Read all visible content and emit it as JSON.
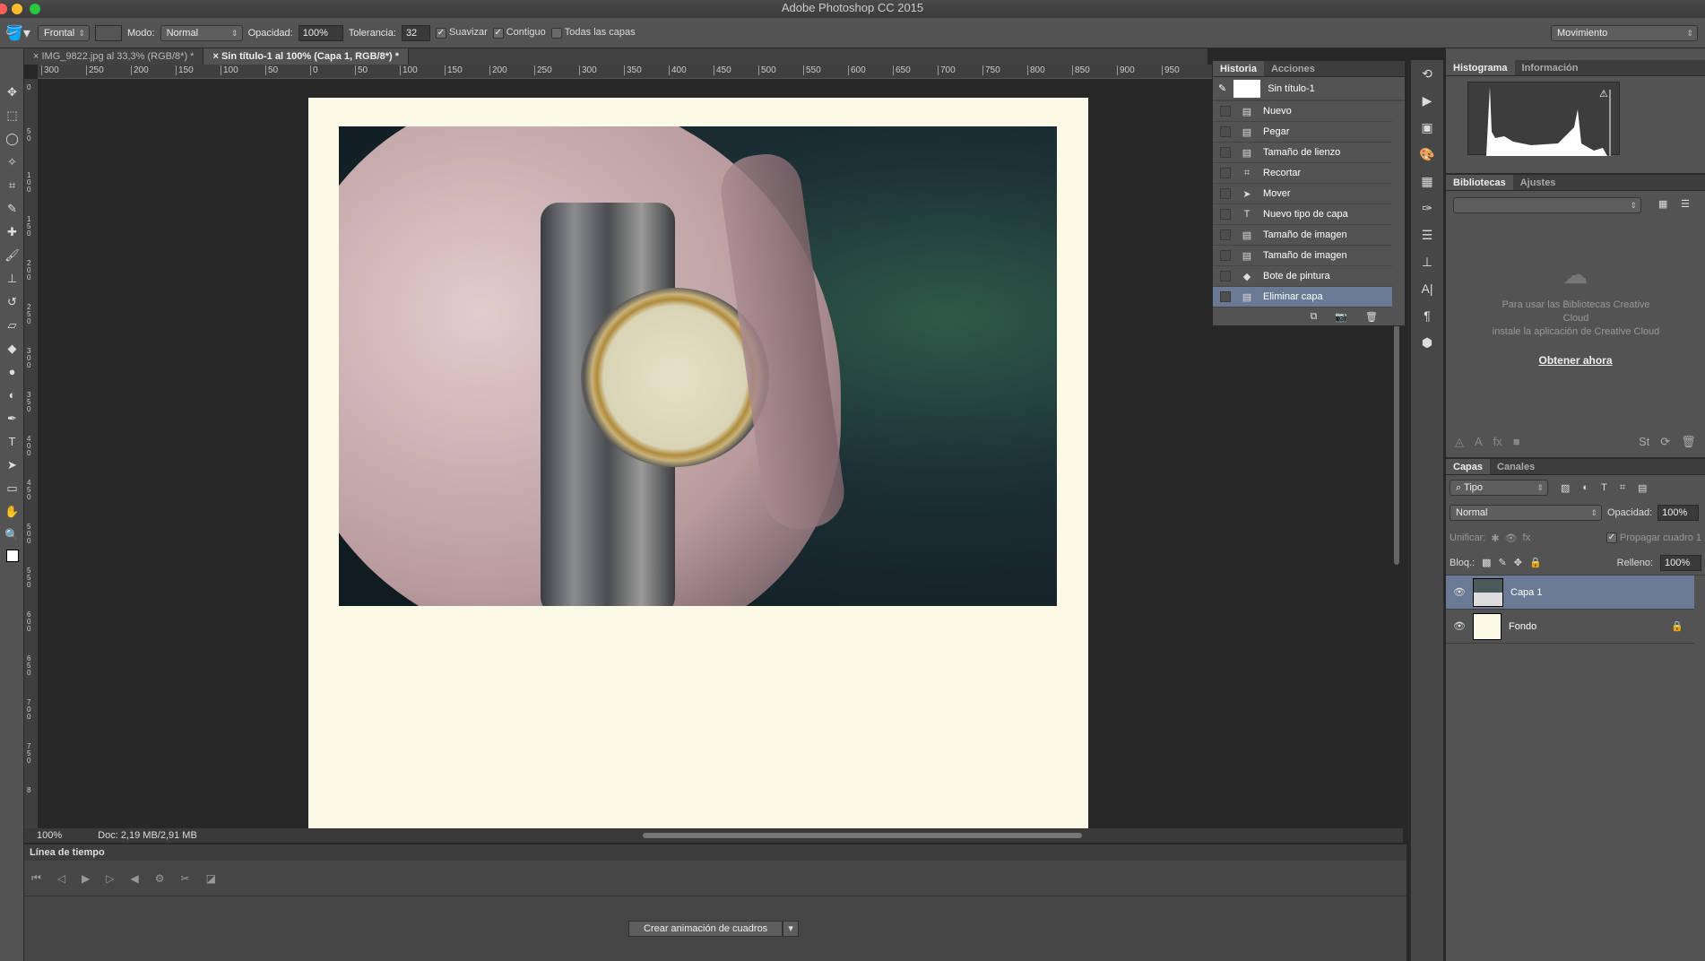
{
  "app": {
    "title": "Adobe Photoshop CC 2015"
  },
  "options": {
    "tool_icon": "paint-bucket-icon",
    "source": "Frontal",
    "mode_label": "Modo:",
    "mode": "Normal",
    "opacity_label": "Opacidad:",
    "opacity": "100%",
    "tolerance_label": "Tolerancia:",
    "tolerance": "32",
    "antialias": "Suavizar",
    "contiguous": "Contiguo",
    "all_layers": "Todas las capas",
    "workspace": "Movimiento"
  },
  "tabs": [
    {
      "label": "IMG_9822.jpg al 33,3% (RGB/8*) *"
    },
    {
      "label": "Sin título-1 al 100% (Capa 1, RGB/8*) *"
    }
  ],
  "ruler": [
    "300",
    "250",
    "200",
    "150",
    "100",
    "50",
    "0",
    "50",
    "100",
    "150",
    "200",
    "250",
    "300",
    "350",
    "400",
    "450",
    "500",
    "550",
    "600",
    "650",
    "700",
    "750",
    "800",
    "850",
    "900",
    "950"
  ],
  "vruler": [
    "0",
    "5 0",
    "1 0 0",
    "1 5 0",
    "2 0 0",
    "2 5 0",
    "3 0 0",
    "3 5 0",
    "4 0 0",
    "4 5 0",
    "5 0 0",
    "5 5 0",
    "6 0 0",
    "6 5 0",
    "7 0 0",
    "7 5 0",
    "8"
  ],
  "status": {
    "zoom": "100%",
    "doc": "Doc: 2,19 MB/2,91 MB"
  },
  "timeline": {
    "title": "Línea de tiempo",
    "create_button": "Crear animación de cuadros"
  },
  "history": {
    "tabs": [
      "Historia",
      "Acciones"
    ],
    "snapshot": "Sin título-1",
    "items": [
      {
        "label": "Nuevo",
        "icon": "document-icon"
      },
      {
        "label": "Pegar",
        "icon": "document-icon"
      },
      {
        "label": "Tamaño de lienzo",
        "icon": "document-icon"
      },
      {
        "label": "Recortar",
        "icon": "crop-icon"
      },
      {
        "label": "Mover",
        "icon": "move-icon"
      },
      {
        "label": "Nuevo tipo de capa",
        "icon": "type-icon"
      },
      {
        "label": "Tamaño de imagen",
        "icon": "image-size-icon"
      },
      {
        "label": "Tamaño de imagen",
        "icon": "image-size-icon"
      },
      {
        "label": "Bote de pintura",
        "icon": "paint-bucket-icon"
      },
      {
        "label": "Eliminar capa",
        "icon": "document-icon",
        "selected": true
      }
    ]
  },
  "histogram": {
    "tabs": [
      "Histograma",
      "Información"
    ]
  },
  "libraries": {
    "tabs": [
      "Bibliotecas",
      "Ajustes"
    ],
    "message1": "Para usar las Bibliotecas Creative Cloud",
    "message2": "instale la aplicación de Creative Cloud",
    "link": "Obtener ahora"
  },
  "layers": {
    "tabs": [
      "Capas",
      "Canales"
    ],
    "filter": "Tipo",
    "blend": "Normal",
    "opacity_label": "Opacidad:",
    "opacity": "100%",
    "unify_label": "Unificar:",
    "propagate": "Propagar cuadro 1",
    "lock_label": "Bloq.:",
    "fill_label": "Relleno:",
    "fill": "100%",
    "items": [
      {
        "name": "Capa 1",
        "selected": true
      },
      {
        "name": "Fondo",
        "locked": true
      }
    ]
  },
  "colors": {
    "accent_selected": "#6b7a94",
    "paper": "#fbfae6"
  }
}
